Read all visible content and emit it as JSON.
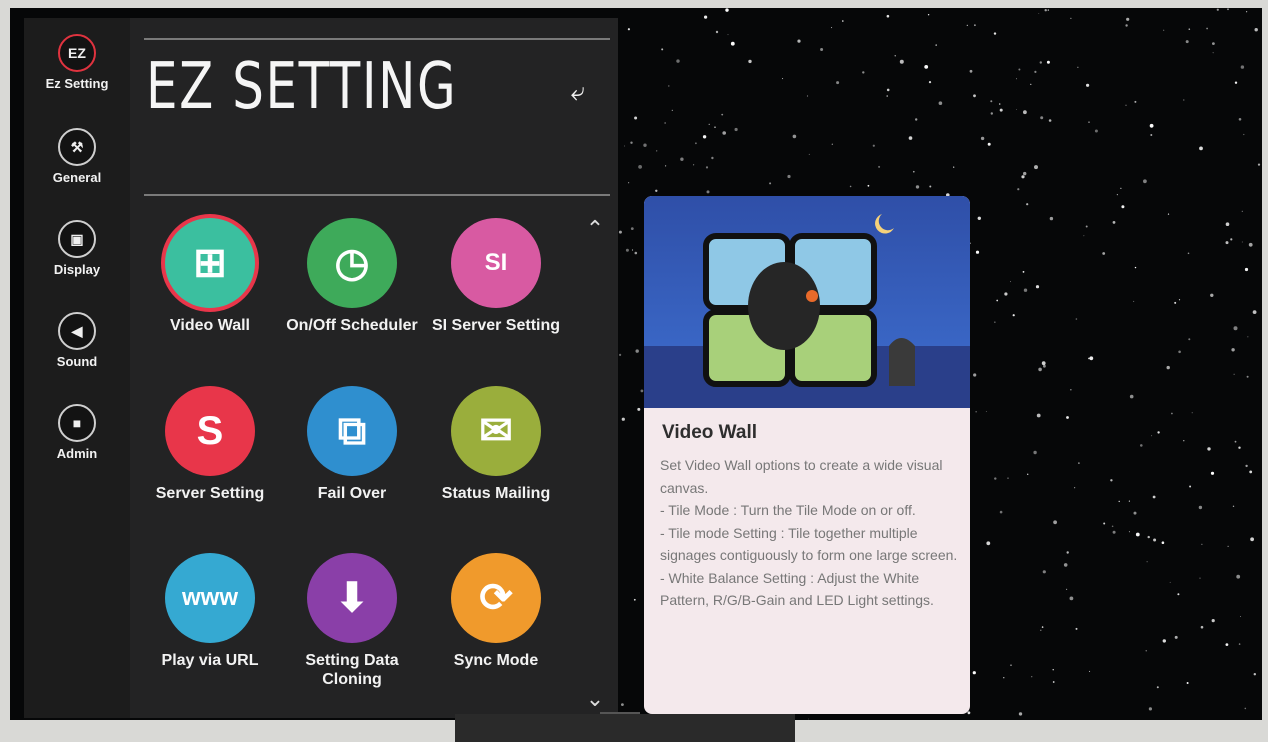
{
  "header": {
    "title": "EZ SETTING"
  },
  "rail": [
    {
      "label": "Ez Setting",
      "icon": "ez-icon",
      "glyph": "EZ",
      "active": true
    },
    {
      "label": "General",
      "icon": "wrench-gear-icon",
      "glyph": "⚒"
    },
    {
      "label": "Display",
      "icon": "monitor-icon",
      "glyph": "▣"
    },
    {
      "label": "Sound",
      "icon": "speaker-icon",
      "glyph": "◀"
    },
    {
      "label": "Admin",
      "icon": "lock-icon",
      "glyph": "■"
    }
  ],
  "tiles": [
    {
      "label": "Video Wall",
      "color": "#3bbf9f",
      "icon": "video-wall-icon",
      "selected": true
    },
    {
      "label": "On/Off Scheduler",
      "color": "#3eaa5a",
      "icon": "scheduler-icon"
    },
    {
      "label": "SI Server Setting",
      "color": "#d85aa2",
      "icon": "si-server-icon"
    },
    {
      "label": "Server Setting",
      "color": "#e8364a",
      "icon": "server-icon"
    },
    {
      "label": "Fail Over",
      "color": "#2f8fcf",
      "icon": "fail-over-icon"
    },
    {
      "label": "Status Mailing",
      "color": "#9aae3c",
      "icon": "mail-icon"
    },
    {
      "label": "Play via URL",
      "color": "#35a9d2",
      "icon": "www-icon"
    },
    {
      "label": "Setting Data Cloning",
      "color": "#8a3fa8",
      "icon": "cloning-icon"
    },
    {
      "label": "Sync Mode",
      "color": "#f09a2c",
      "icon": "sync-icon"
    }
  ],
  "info": {
    "title": "Video Wall",
    "body": "Set Video Wall options to create a wide visual canvas.\n- Tile Mode : Turn the Tile Mode on or off.\n- Tile mode Setting : Tile together multiple signages contiguously to form one large screen.\n- White Balance Setting : Adjust the White Pattern, R/G/B-Gain and LED Light settings."
  },
  "colors": {
    "accent": "#e8364a",
    "panel": "#2a2a2a"
  }
}
